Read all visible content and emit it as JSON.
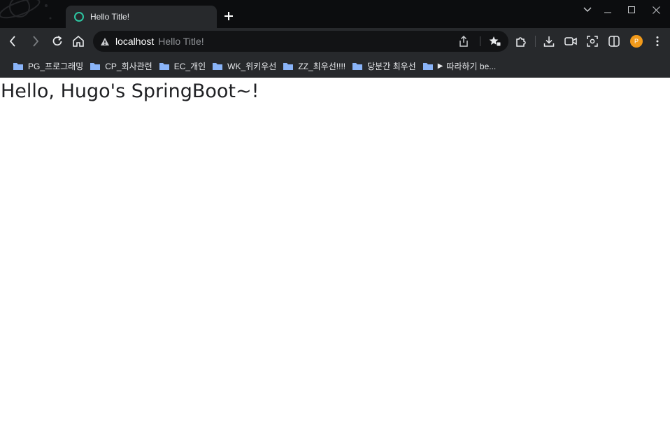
{
  "browser": {
    "tab": {
      "title": "Hello Title!"
    },
    "omnibox": {
      "host": "localhost",
      "page_title": "Hello Title!"
    },
    "avatar_initial": "P",
    "colors": {
      "accent_favicon": "#2dc5a1",
      "avatar": "#f29a1a",
      "chrome_bg": "#27292c"
    }
  },
  "bookmarks": [
    {
      "label": "PG_프로그래밍"
    },
    {
      "label": "CP_회사관련"
    },
    {
      "label": "EC_개인"
    },
    {
      "label": "WK_위키우선"
    },
    {
      "label": "ZZ_최우선!!!!"
    },
    {
      "label": "당분간 최우선"
    },
    {
      "label": "따라하기 be..."
    }
  ],
  "page": {
    "heading": "Hello, Hugo's SpringBoot~!"
  }
}
